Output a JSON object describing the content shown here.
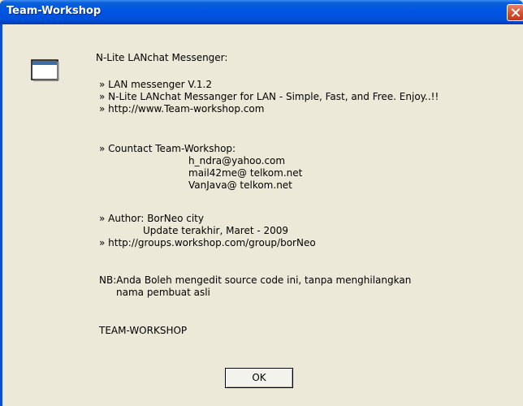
{
  "window": {
    "title": "Team-Workshop",
    "close_icon": "close-icon"
  },
  "content": {
    "heading": "N-Lite LANchat Messenger:",
    "info_lines": [
      "» LAN messenger V.1.2",
      "» N-Lite LANchat Messanger for LAN - Simple, Fast, and Free. Enjoy..!!",
      "» http://www.Team-workshop.com"
    ],
    "contact_label": "» Countact Team-Workshop:",
    "contacts": [
      "h_ndra@yahoo.com",
      "mail42me@ telkom.net",
      "VanJava@ telkom.net"
    ],
    "author_label": "» Author: BorNeo city",
    "update_line": "Update terakhir, Maret - 2009",
    "group_url": "» http://groups.workshop.com/group/borNeo",
    "note_line1": "NB:Anda Boleh mengedit source code ini, tanpa menghilangkan",
    "note_line2": "nama pembuat asli",
    "signature": "TEAM-WORKSHOP"
  },
  "buttons": {
    "ok_label": "OK"
  },
  "colors": {
    "titlebar": "#0054e3",
    "dialog_background": "#ece9d8",
    "close_button": "#d4502e"
  },
  "icons": {
    "app": "window-icon"
  }
}
